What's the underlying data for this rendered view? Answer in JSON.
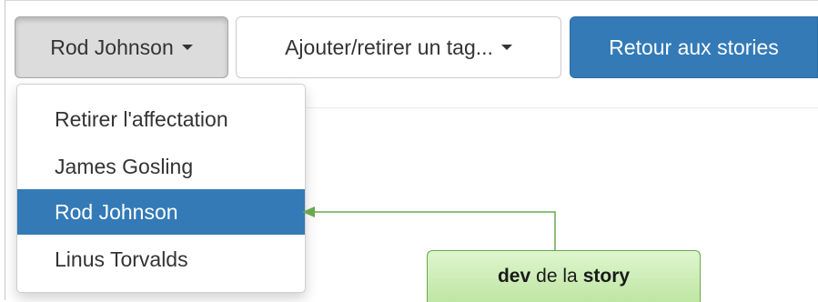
{
  "toolbar": {
    "assignee_button_label": "Rod Johnson",
    "tag_button_label": "Ajouter/retirer un tag...",
    "back_button_label": "Retour aux stories"
  },
  "dropdown": {
    "items": [
      {
        "label": "Retirer l'affectation",
        "active": false
      },
      {
        "label": "James Gosling",
        "active": false
      },
      {
        "label": "Rod Johnson",
        "active": true
      },
      {
        "label": "Linus Torvalds",
        "active": false
      }
    ]
  },
  "annotation": {
    "part1": "dev",
    "part2": "de la",
    "part3": "story"
  },
  "colors": {
    "primary": "#337ab7",
    "annotation_green": "#6aa84f",
    "callout_fill_top": "#def5cd",
    "callout_fill_bottom": "#bfe6a4"
  },
  "icons": {
    "dropdown_caret": "caret-down-icon"
  }
}
